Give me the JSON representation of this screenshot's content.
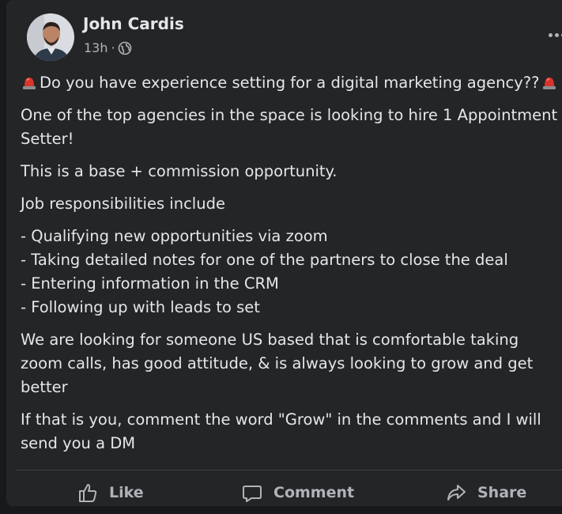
{
  "post": {
    "author": "John Cardis",
    "time": "13h",
    "separator": "·",
    "privacy_icon": "globe-icon",
    "menu_icon": "more-options-icon",
    "lines": {
      "l1": "Do you have experience setting for a digital marketing agency??",
      "l2": "One of the top agencies in the space is looking to hire 1 Appointment",
      "l3": "Setter!",
      "l4": "This is a base + commission opportunity.",
      "l5": "Job responsibilities include",
      "l6": "- Qualifying new opportunities via zoom",
      "l7": "- Taking detailed notes for one of the partners to close the deal",
      "l8": "- Entering information in the CRM",
      "l9": "- Following up with leads to set",
      "l10": "We are looking for someone US based that is comfortable taking",
      "l11": "zoom calls, has good attitude, & is always looking to grow and get",
      "l12": "better",
      "l13": "If that is you, comment the word \"Grow\" in the comments and I will",
      "l14": "send you a DM"
    },
    "emoji_icon": "siren-icon"
  },
  "actions": {
    "like": "Like",
    "comment": "Comment",
    "share": "Share"
  },
  "colors": {
    "background": "#18191a",
    "card": "#242526",
    "primary_text": "#e4e6eb",
    "secondary_text": "#b0b3b8"
  }
}
